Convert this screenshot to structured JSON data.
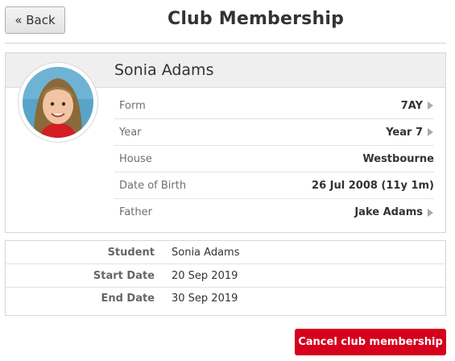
{
  "header": {
    "back_label": "« Back",
    "title": "Club Membership"
  },
  "profile": {
    "name": "Sonia Adams",
    "details": [
      {
        "label": "Form",
        "value": "7AY",
        "has_link": true
      },
      {
        "label": "Year",
        "value": "Year 7",
        "has_link": true
      },
      {
        "label": "House",
        "value": "Westbourne",
        "has_link": false
      },
      {
        "label": "Date of Birth",
        "value": "26 Jul 2008 (11y 1m)",
        "has_link": false
      },
      {
        "label": "Father",
        "value": "Jake Adams",
        "has_link": true
      }
    ]
  },
  "membership": {
    "rows": [
      {
        "label": "Student",
        "value": "Sonia Adams"
      },
      {
        "label": "Start Date",
        "value": "20 Sep 2019"
      },
      {
        "label": "End Date",
        "value": "30 Sep 2019"
      }
    ]
  },
  "actions": {
    "cancel_label": "Cancel club membership"
  },
  "colors": {
    "danger": "#d6001c",
    "header_bg": "#efefef",
    "border": "#d6d6d6"
  }
}
